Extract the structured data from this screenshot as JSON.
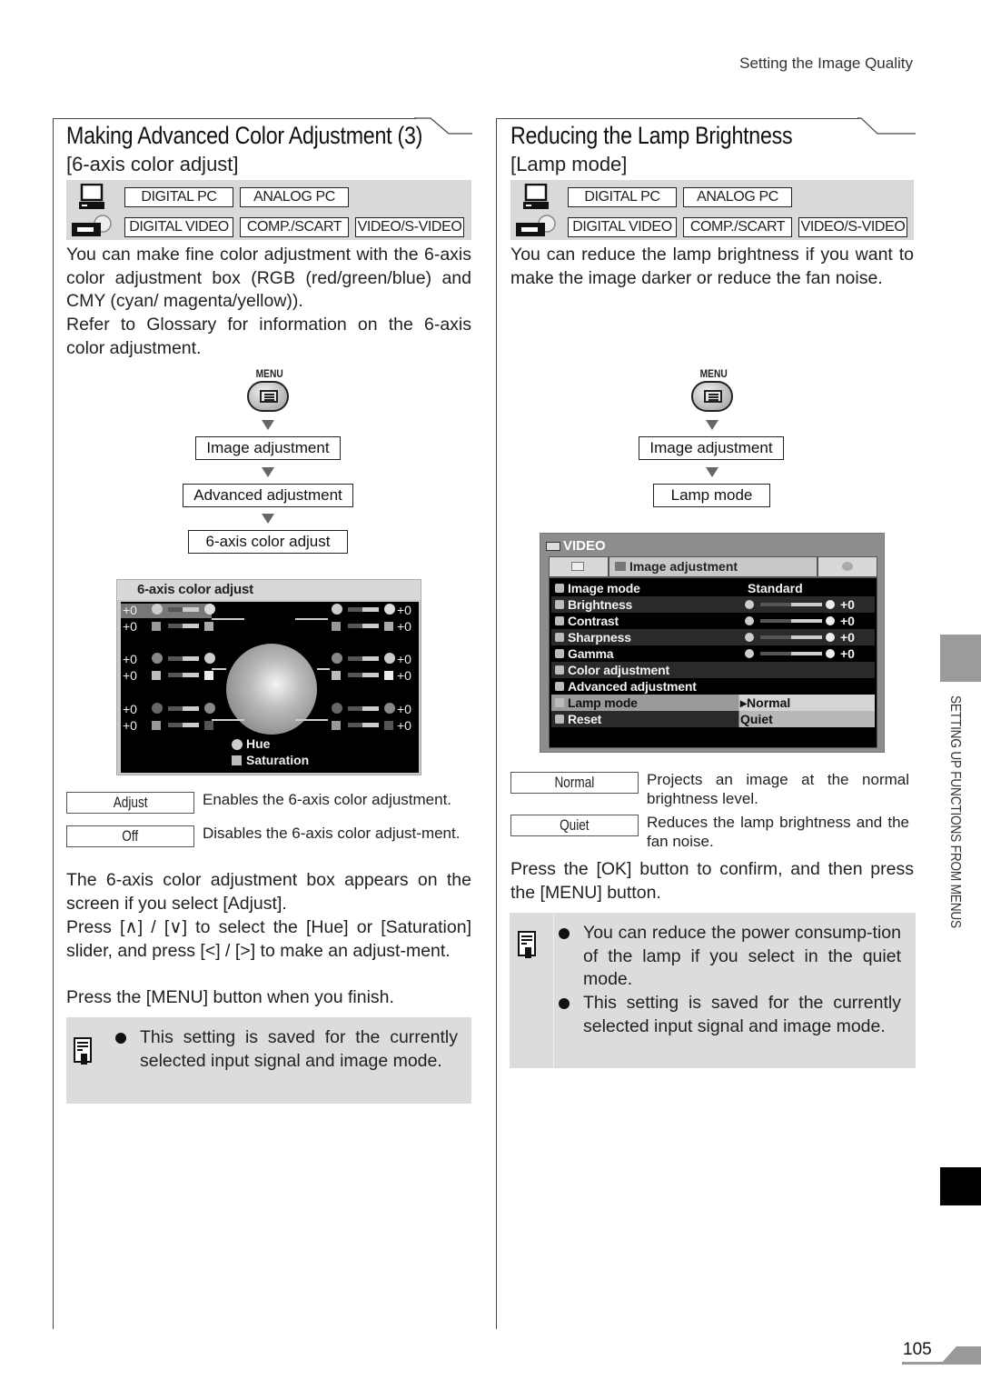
{
  "running_head": "Setting the Image Quality",
  "side_tab_label": "SETTING UP FUNCTIONS FROM MENUS",
  "page_number": "105",
  "signal_tags": {
    "row1": [
      "DIGITAL PC",
      "ANALOG PC"
    ],
    "row2": [
      "DIGITAL VIDEO",
      "COMP./SCART",
      "VIDEO/S-VIDEO"
    ]
  },
  "menu_button_label": "MENU",
  "left": {
    "title": "Making Advanced Color Adjustment (3)",
    "subtitle": "[6-axis color adjust]",
    "intro_1": "You can make fine color adjustment with the 6-axis color adjustment box (RGB (red/green/blue) and CMY (cyan/ magenta/yellow)).",
    "intro_2": "Refer to Glossary for information on the 6-axis color adjustment.",
    "steps": [
      "Image adjustment",
      "Advanced adjustment",
      "6-axis color adjust"
    ],
    "screen": {
      "title": "6-axis color adjust",
      "values": [
        "+0",
        "+0",
        "+0",
        "+0",
        "+0",
        "+0",
        "+0",
        "+0",
        "+0",
        "+0",
        "+0",
        "+0"
      ],
      "legend_hue": "Hue",
      "legend_saturation": "Saturation"
    },
    "options": [
      {
        "label": "Adjust",
        "desc": "Enables the 6-axis color adjustment."
      },
      {
        "label": "Off",
        "desc": "Disables the 6-axis color adjust-ment."
      }
    ],
    "body_1": "The 6-axis color adjustment box appears on the screen if you select [Adjust].",
    "body_2": "Press [∧] / [∨] to select the [Hue] or [Saturation] slider, and press [<] / [>] to make an adjust-ment.",
    "body_3": "Press the [MENU] button when you finish.",
    "notes": [
      "This setting is saved for the currently selected input signal and image mode."
    ]
  },
  "right": {
    "title": "Reducing the Lamp Brightness",
    "subtitle": "[Lamp mode]",
    "intro": "You can reduce the lamp brightness if you want to make the image darker or reduce the fan noise.",
    "steps": [
      "Image adjustment",
      "Lamp mode"
    ],
    "screen": {
      "source": "VIDEO",
      "tab": "Image adjustment",
      "rows": [
        {
          "label": "Image mode",
          "value": "Standard"
        },
        {
          "label": "Brightness",
          "value": "+0",
          "slider": 0.5
        },
        {
          "label": "Contrast",
          "value": "+0",
          "slider": 0.5
        },
        {
          "label": "Sharpness",
          "value": "+0",
          "slider": 0.5
        },
        {
          "label": "Gamma",
          "value": "+0",
          "slider": 0.5
        },
        {
          "label": "Color adjustment"
        },
        {
          "label": "Advanced adjustment"
        },
        {
          "label": "Lamp mode",
          "value": "▸Normal"
        },
        {
          "label": "Reset",
          "value": "Quiet"
        }
      ]
    },
    "options": [
      {
        "label": "Normal",
        "desc": "Projects an image at the normal brightness level."
      },
      {
        "label": "Quiet",
        "desc": "Reduces the lamp brightness and the fan noise."
      }
    ],
    "body_1": "Press the [OK] button to confirm, and then press the [MENU] button.",
    "notes": [
      "You can reduce the power consump-tion of the lamp if you select in the quiet mode.",
      "This setting is saved for the currently selected input signal and image mode."
    ]
  }
}
